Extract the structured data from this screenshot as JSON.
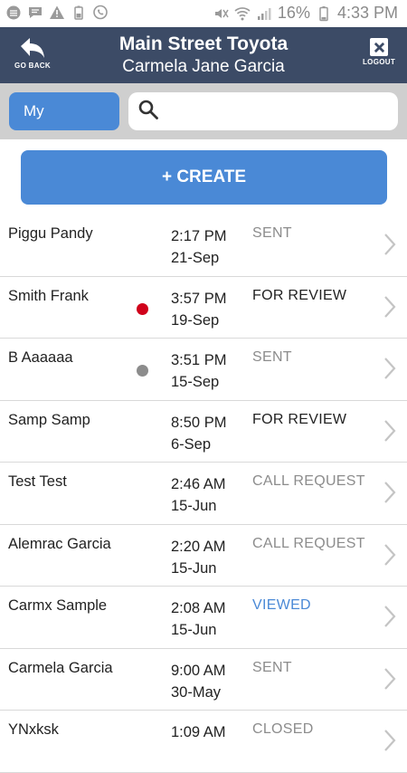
{
  "status_bar": {
    "battery": "16%",
    "time": "4:33 PM",
    "left_icons": [
      "signal-circle-icon",
      "message-icon",
      "warning-icon",
      "battery-small-icon",
      "viber-icon"
    ],
    "right_icons": [
      "mute-icon",
      "wifi-icon",
      "cell-signal-icon",
      "battery-icon"
    ]
  },
  "header": {
    "back_label": "GO BACK",
    "title": "Main Street Toyota",
    "subtitle": "Carmela Jane Garcia",
    "logout_label": "LOGOUT"
  },
  "filter": {
    "my_label": "My",
    "search_value": "",
    "search_placeholder": ""
  },
  "create_label": "+ CREATE",
  "colors": {
    "header_bg": "#3c4b66",
    "accent_blue": "#4a89d6",
    "status_gray": "#8c8c8c",
    "status_dark": "#222222",
    "status_viewed": "#4a89d6",
    "dot_red": "#d0021b",
    "dot_gray": "#8c8c8c"
  },
  "items": [
    {
      "name": "Piggu Pandy",
      "time": "2:17 PM",
      "date": "21-Sep",
      "status": "SENT",
      "status_color": "#8c8c8c",
      "dot": ""
    },
    {
      "name": "Smith Frank",
      "time": "3:57 PM",
      "date": "19-Sep",
      "status": "FOR REVIEW",
      "status_color": "#222222",
      "dot": "#d0021b"
    },
    {
      "name": "B Aaaaaa",
      "time": "3:51 PM",
      "date": "15-Sep",
      "status": "SENT",
      "status_color": "#8c8c8c",
      "dot": "#8c8c8c"
    },
    {
      "name": "Samp Samp",
      "time": "8:50 PM",
      "date": "6-Sep",
      "status": "FOR REVIEW",
      "status_color": "#222222",
      "dot": ""
    },
    {
      "name": "Test Test",
      "time": "2:46 AM",
      "date": "15-Jun",
      "status": "CALL REQUEST",
      "status_color": "#8c8c8c",
      "dot": ""
    },
    {
      "name": "Alemrac Garcia",
      "time": "2:20 AM",
      "date": "15-Jun",
      "status": "CALL REQUEST",
      "status_color": "#8c8c8c",
      "dot": ""
    },
    {
      "name": "Carmx Sample",
      "time": "2:08 AM",
      "date": "15-Jun",
      "status": "VIEWED",
      "status_color": "#4a89d6",
      "dot": ""
    },
    {
      "name": "Carmela Garcia",
      "time": "9:00 AM",
      "date": "30-May",
      "status": "SENT",
      "status_color": "#8c8c8c",
      "dot": ""
    },
    {
      "name": "YNxksk",
      "time": "1:09 AM",
      "date": "",
      "status": "CLOSED",
      "status_color": "#8c8c8c",
      "dot": ""
    }
  ]
}
